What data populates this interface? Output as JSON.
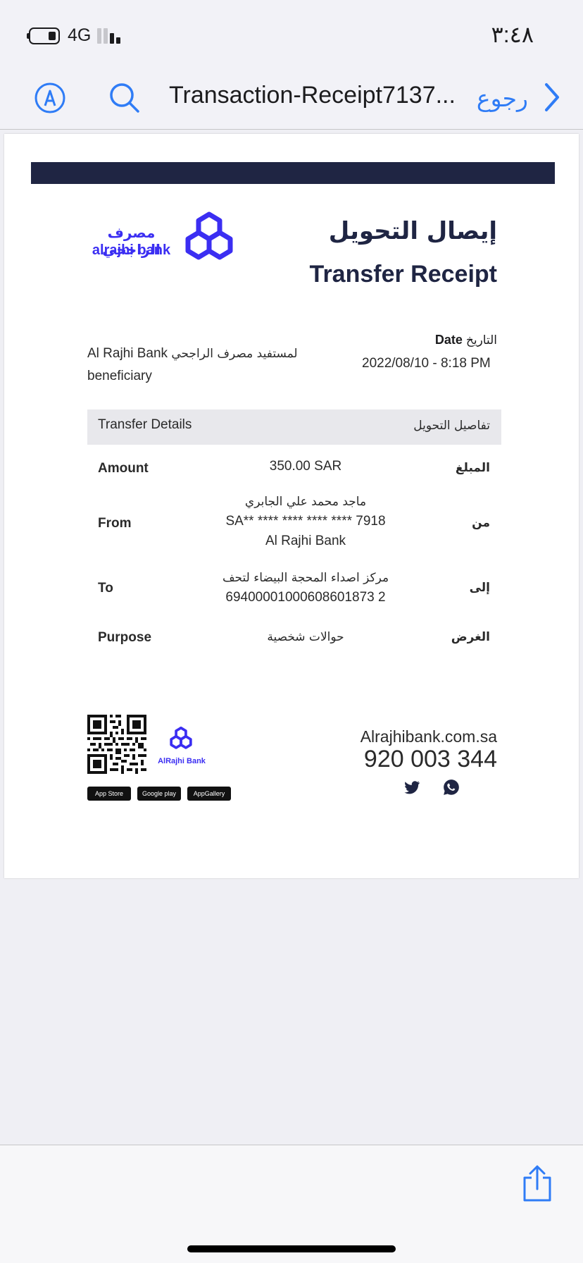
{
  "status_bar": {
    "time": "٣:٤٨",
    "network": "4G"
  },
  "nav": {
    "title": "Transaction-Receipt7137...",
    "back_label": "رجوع"
  },
  "receipt": {
    "logo_ar": "مصرف الراجحي",
    "logo_en": "alrajhi bank",
    "title_ar": "إيصال التحويل",
    "title_en": "Transfer Receipt",
    "beneficiary_en": "Al Rajhi Bank",
    "beneficiary_ar": "لمستفيد مصرف الراجحي",
    "beneficiary_en2": "beneficiary",
    "date_label_en": "Date",
    "date_label_ar": "التاريخ",
    "date_value": "2022/08/10 - 8:18 PM",
    "details_header_en": "Transfer Details",
    "details_header_ar": "تفاصيل التحويل",
    "rows": [
      {
        "label_en": "Amount",
        "label_ar": "المبلغ",
        "value": "350.00 SAR"
      },
      {
        "label_en": "From",
        "label_ar": "من",
        "value_line1": "ماجد محمد علي الجابري",
        "value_line2": "SA** **** **** **** **** 7918",
        "value_line3": "Al Rajhi Bank"
      },
      {
        "label_en": "To",
        "label_ar": "إلى",
        "value_line1": "مركز اصداء المحجة البيضاء لتحف",
        "value_line2": "69400001000608601873 2"
      },
      {
        "label_en": "Purpose",
        "label_ar": "الغرض",
        "value": "حوالات شخصية"
      }
    ],
    "small_logo_text": "AlRajhi Bank",
    "stores": [
      "App Store",
      "Google play",
      "AppGallery"
    ],
    "website": "Alrajhibank.com.sa",
    "phone": "920 003 344"
  },
  "colors": {
    "accent": "#2f7cf6",
    "brand": "#3b2ef2",
    "navy": "#1f2543"
  }
}
